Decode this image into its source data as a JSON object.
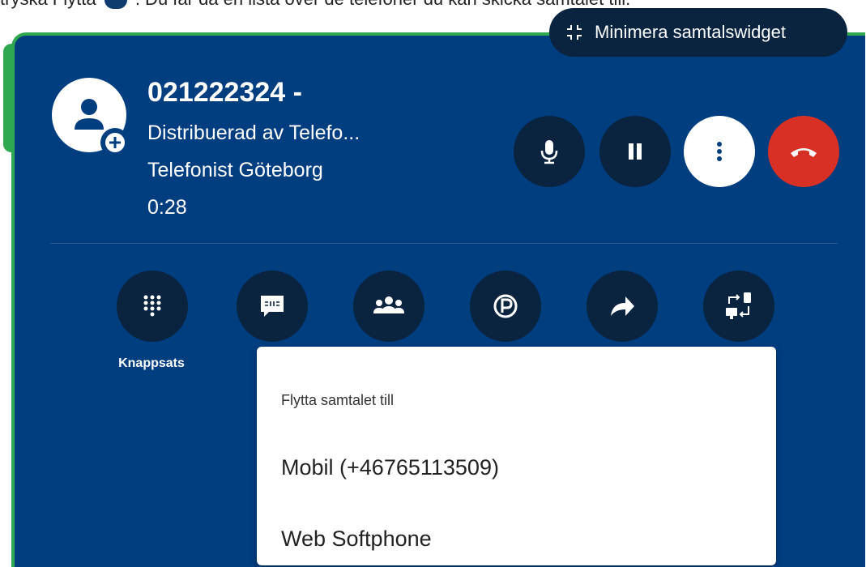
{
  "top_caption": {
    "before": "tryska Flytta",
    "after": ". Du får då en lista över de telefoner du kan skicka samtalet till."
  },
  "widget": {
    "minimize_label": "Minimera samtalswidget",
    "caller": {
      "number": "021222324 -",
      "distributed_by": "Distribuerad av Telefo...",
      "operator": "Telefonist Göteborg",
      "duration": "0:28"
    },
    "call_controls": [
      {
        "name": "microphone-button",
        "icon": "microphone-icon"
      },
      {
        "name": "hold-button",
        "icon": "pause-icon"
      },
      {
        "name": "more-button",
        "icon": "more-vertical-icon"
      },
      {
        "name": "hangup-button",
        "icon": "phone-hangup-icon"
      }
    ],
    "actions": [
      {
        "icon": "keypad-icon",
        "label": "Knappsats"
      },
      {
        "icon": "sms-icon",
        "label": ""
      },
      {
        "icon": "group-icon",
        "label": ""
      },
      {
        "icon": "park-icon",
        "label": ""
      },
      {
        "icon": "forward-icon",
        "label": ""
      },
      {
        "icon": "move-call-icon",
        "label": ""
      }
    ],
    "colors": {
      "panel": "#003e80",
      "border": "#2fa84f",
      "dark_button": "#0a2440",
      "hangup": "#d93025"
    }
  },
  "move_menu": {
    "heading": "Flytta samtalet till",
    "items": [
      "Mobil (+46765113509)",
      "Web Softphone"
    ]
  }
}
